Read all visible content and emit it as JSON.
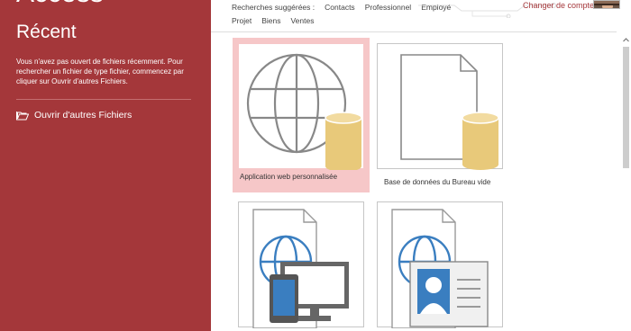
{
  "left_panel": {
    "app_name": "Access",
    "recent_heading": "Récent",
    "info_text": "Vous n'avez pas ouvert de fichiers récemment. Pour rechercher un fichier de type fichier, commencez par cliquer sur Ouvrir d'autres Fichiers.",
    "open_other_label": "Ouvrir d'autres Fichiers"
  },
  "header": {
    "suggested_label": "Recherches suggérées :",
    "suggestions_row1": [
      "Contacts",
      "Professionnel",
      "Employé"
    ],
    "suggestions_row2": [
      "Projet",
      "Biens",
      "Ventes"
    ],
    "switch_account": "Changer de compte"
  },
  "templates": [
    {
      "label": "Application web personnalisée",
      "selected": true
    },
    {
      "label": "Base de données du Bureau vide",
      "selected": false
    },
    {
      "label": "",
      "selected": false
    },
    {
      "label": "",
      "selected": false
    }
  ],
  "colors": {
    "brand": "#a4373a",
    "db_cylinder": "#e8c97a",
    "globe_blue": "#3a7ec0",
    "selection": "#f6c7c8"
  }
}
